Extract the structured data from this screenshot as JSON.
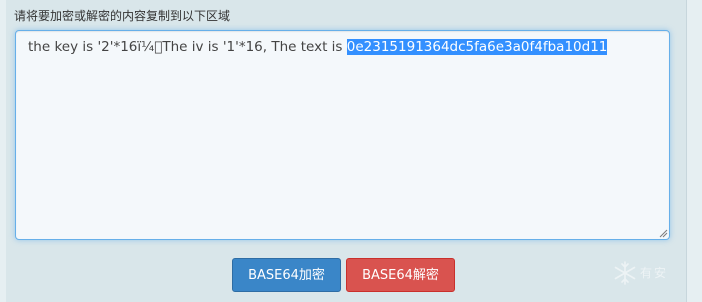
{
  "form": {
    "label": "请将要加密或解密的内容复制到以下区域",
    "textarea_text": "the key is '2'*16ï¼\u0000The iv is '1'*16, The text is ",
    "selected_text": "0e2315191364dc5fa6e3a0f4fba10d11"
  },
  "buttons": {
    "encode_label": "BASE64加密",
    "decode_label": "BASE64解密"
  },
  "watermark": {
    "text": "有安"
  },
  "colors": {
    "encode": "#3a86c8",
    "decode": "#d9534f",
    "selection": "#3390ff",
    "focus_border": "#66afe9"
  }
}
